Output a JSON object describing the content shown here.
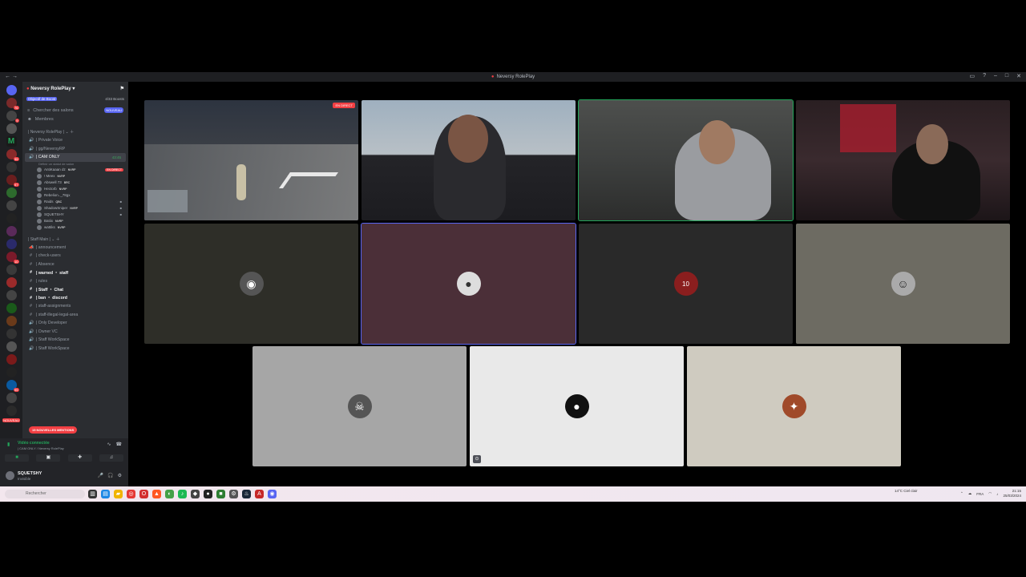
{
  "window": {
    "title": "Neversy RolePlay"
  },
  "server": {
    "name": "Neversy RolePlay",
    "boost_goal": "Objectif de Boost",
    "boost_count": "4/33 Boosts",
    "search_channels": "Chercher des salons",
    "new_badge": "NOUVEAU",
    "members": "Membres"
  },
  "categories": {
    "main": "| Neversy RolePlay |",
    "staff": "| Staff Main |"
  },
  "channels_main": [
    {
      "label": "| Private Voice",
      "icon": "voice-icon"
    },
    {
      "label": "| gg/NeversyRP",
      "icon": "voice-icon"
    },
    {
      "label": "| CAM ONLY",
      "icon": "voice-icon",
      "count": "43:45"
    }
  ],
  "cam_only_sub": "Définir un statut de salon",
  "voice_users": [
    {
      "name": "AntiKaaan dz",
      "tag": "NVRP",
      "live": "EN DIRECT"
    },
    {
      "name": "! Meex",
      "tag": "NVRP"
    },
    {
      "name": "Abswell 73",
      "tag": "BRC"
    },
    {
      "name": "Hectorb",
      "tag": "NVRP"
    },
    {
      "name": "Rebelion.._78gx",
      "tag": ""
    },
    {
      "name": "Raids",
      "tag": "QBC",
      "cam": true
    },
    {
      "name": "ShadowSniper",
      "tag": "NVRP",
      "cam": true
    },
    {
      "name": "SQUETSHY",
      "tag": "",
      "cam": true
    },
    {
      "name": "Batiix",
      "tag": "NVRP"
    },
    {
      "name": "wattiks",
      "tag": "NVRP"
    }
  ],
  "channels_staff": [
    {
      "label": "| announcement",
      "icon": "megaphone-icon",
      "bold": false
    },
    {
      "label": "| check-users",
      "icon": "text-icon",
      "bold": false
    },
    {
      "label": "| Absence",
      "icon": "text-icon",
      "bold": false
    },
    {
      "label": "| warned ・ staff",
      "icon": "text-icon",
      "bold": true
    },
    {
      "label": "| rules",
      "icon": "text-icon",
      "bold": false
    },
    {
      "label": "| Staff ・ Chat",
      "icon": "text-icon",
      "bold": true
    },
    {
      "label": "| ban ・ discord",
      "icon": "text-icon",
      "bold": true
    },
    {
      "label": "| staff-assignments",
      "icon": "text-icon",
      "bold": false
    },
    {
      "label": "| staff-illegal-legal-area",
      "icon": "text-icon",
      "bold": false
    },
    {
      "label": "| Only Developer",
      "icon": "voice-icon",
      "bold": false
    },
    {
      "label": "| Owner VC",
      "icon": "voice-icon",
      "bold": false
    },
    {
      "label": "| Staff WorkSpace",
      "icon": "voice-icon",
      "bold": false
    },
    {
      "label": "| Staff WorkSpace",
      "icon": "voice-icon",
      "bold": false
    }
  ],
  "mentions_badge": "15 NOUVELLES MENTIONS",
  "guild_new_badge": "NOUVEAU",
  "voice_panel": {
    "status": "Vidéo connectée",
    "channel": "| CAM ONLY / Neversy RolePlay"
  },
  "user_panel": {
    "name": "SQUETSHY",
    "status": "Invisible"
  },
  "stream": {
    "live_label": "EN DIRECT"
  },
  "taskbar": {
    "search": "Rechercher",
    "weather": "14°C Ciel clair",
    "lang": "FRA",
    "time": "21:15",
    "date": "25/03/2024"
  },
  "colors": {
    "accent": "#5865f2",
    "live": "#f23f43",
    "connected": "#23a55a",
    "tile_maroon": "#4b2f38",
    "tile_dark": "#292929",
    "tile_olive": "#2e2e28",
    "tile_khaki": "#6d6b62",
    "tile_gray": "#a6a6a6",
    "tile_white": "#e9e9e9",
    "tile_beige": "#cfcbc0"
  }
}
